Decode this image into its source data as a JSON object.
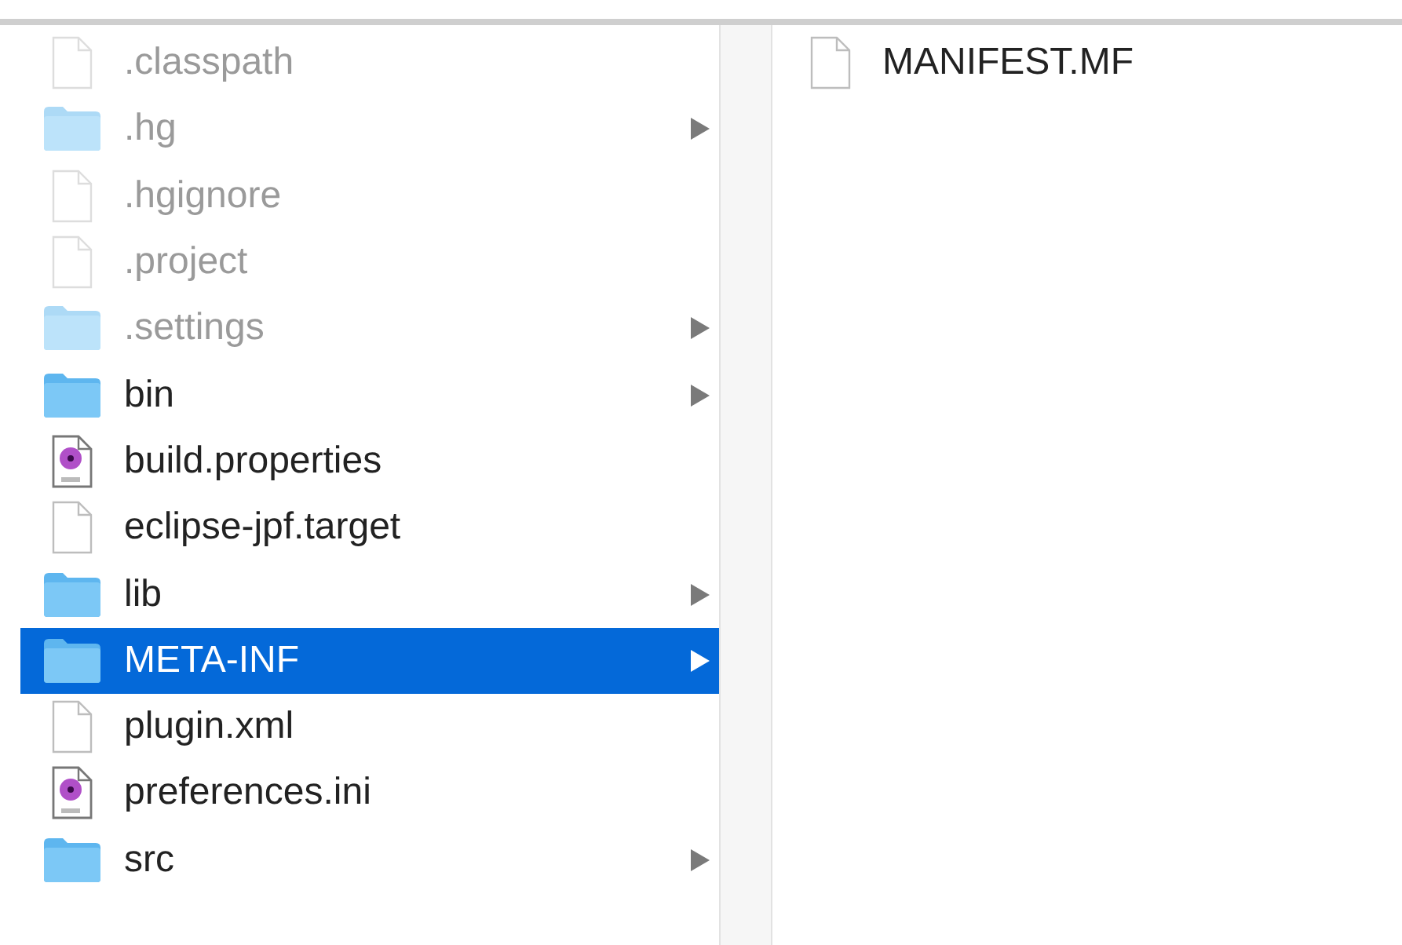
{
  "columns": [
    {
      "items": [
        {
          "name": ".classpath",
          "kind": "file",
          "hidden": true,
          "expandable": false,
          "selected": false
        },
        {
          "name": ".hg",
          "kind": "folder",
          "hidden": true,
          "expandable": true,
          "selected": false
        },
        {
          "name": ".hgignore",
          "kind": "file",
          "hidden": true,
          "expandable": false,
          "selected": false
        },
        {
          "name": ".project",
          "kind": "file",
          "hidden": true,
          "expandable": false,
          "selected": false
        },
        {
          "name": ".settings",
          "kind": "folder",
          "hidden": true,
          "expandable": true,
          "selected": false
        },
        {
          "name": "bin",
          "kind": "folder",
          "hidden": false,
          "expandable": true,
          "selected": false
        },
        {
          "name": "build.properties",
          "kind": "document",
          "hidden": false,
          "expandable": false,
          "selected": false
        },
        {
          "name": "eclipse-jpf.target",
          "kind": "file",
          "hidden": false,
          "expandable": false,
          "selected": false
        },
        {
          "name": "lib",
          "kind": "folder",
          "hidden": false,
          "expandable": true,
          "selected": false
        },
        {
          "name": "META-INF",
          "kind": "folder",
          "hidden": false,
          "expandable": true,
          "selected": true
        },
        {
          "name": "plugin.xml",
          "kind": "file",
          "hidden": false,
          "expandable": false,
          "selected": false
        },
        {
          "name": "preferences.ini",
          "kind": "document",
          "hidden": false,
          "expandable": false,
          "selected": false
        },
        {
          "name": "src",
          "kind": "folder",
          "hidden": false,
          "expandable": true,
          "selected": false
        }
      ]
    },
    {
      "items": [
        {
          "name": "MANIFEST.MF",
          "kind": "file",
          "hidden": false,
          "expandable": false,
          "selected": false
        }
      ]
    }
  ]
}
